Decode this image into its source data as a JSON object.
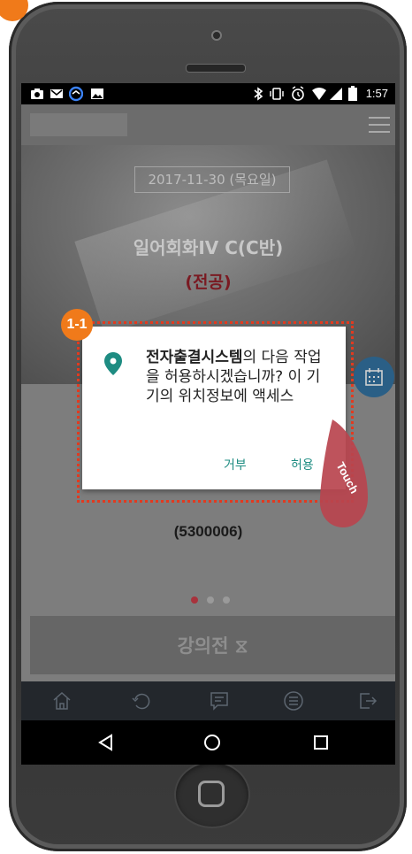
{
  "status_bar": {
    "time": "1:57",
    "left_icons": [
      "photo-icon",
      "mail-icon",
      "sync-icon",
      "image-icon"
    ],
    "right_icons": [
      "bluetooth-icon",
      "vibrate-icon",
      "alarm-icon",
      "wifi-icon",
      "signal-icon",
      "battery-icon"
    ]
  },
  "hero": {
    "date": "2017-11-30 (목요일)",
    "course_name": "일어회화IV C(C반)",
    "course_type": "(전공)"
  },
  "content": {
    "student_id": "(5300006)",
    "status_button_label": "강의전 ⧖",
    "pager_dots": 3,
    "pager_active_index": 0
  },
  "dialog": {
    "app_name": "전자출결시스템",
    "message_rest": "의 다음 작업을 허용하시겠습니까? 이 기기의 위치정보에 액세스",
    "deny_label": "거부",
    "allow_label": "허용"
  },
  "annotations": {
    "step_label": "1-1",
    "touch_label": "Touch",
    "highlight_color": "#e23a1f",
    "badge_color": "#f07a1a"
  },
  "tabbar": {
    "icons": [
      "home-icon",
      "refresh-icon",
      "message-icon",
      "list-icon",
      "logout-icon"
    ]
  },
  "navbar": {
    "icons": [
      "back-icon",
      "home-circle-icon",
      "recents-icon"
    ]
  }
}
